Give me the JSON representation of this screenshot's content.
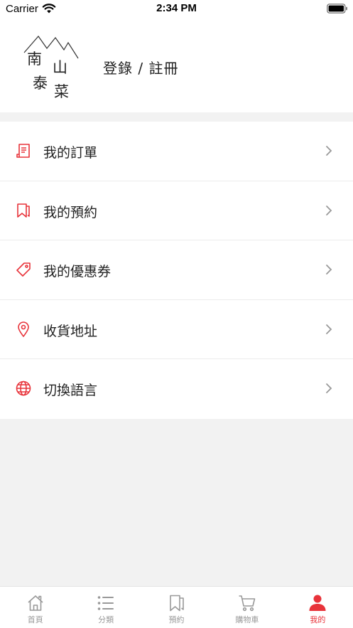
{
  "status_bar": {
    "carrier": "Carrier",
    "time": "2:34 PM"
  },
  "profile": {
    "logo_text": [
      "南",
      "山",
      "泰",
      "菜"
    ],
    "login_label": "登錄 / 註冊"
  },
  "menu": [
    {
      "label": "我的訂單",
      "icon": "order-receipt-icon"
    },
    {
      "label": "我的預約",
      "icon": "bookmark-icon"
    },
    {
      "label": "我的優惠券",
      "icon": "coupon-tag-icon"
    },
    {
      "label": "收貨地址",
      "icon": "location-pin-icon"
    },
    {
      "label": "切換語言",
      "icon": "globe-icon"
    }
  ],
  "tabbar": [
    {
      "label": "首頁",
      "icon": "home-icon",
      "active": false
    },
    {
      "label": "分類",
      "icon": "list-icon",
      "active": false
    },
    {
      "label": "預約",
      "icon": "bookmark-icon",
      "active": false
    },
    {
      "label": "購物車",
      "icon": "cart-icon",
      "active": false
    },
    {
      "label": "我的",
      "icon": "user-icon",
      "active": true
    }
  ],
  "colors": {
    "accent": "#e8333a",
    "inactive": "#999999",
    "background": "#f2f2f2"
  }
}
